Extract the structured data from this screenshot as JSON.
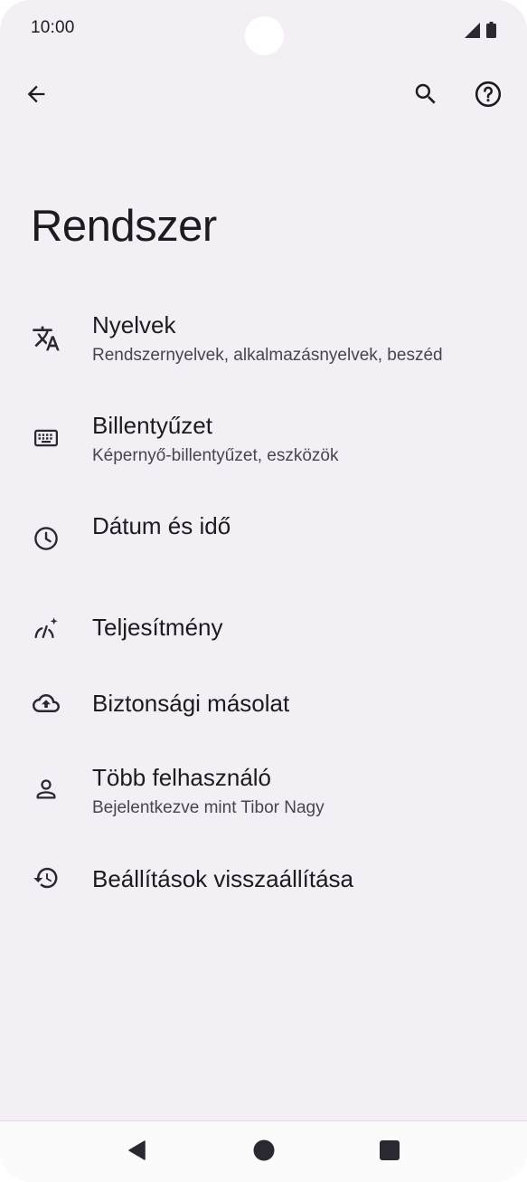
{
  "status_bar": {
    "time": "10:00"
  },
  "app_bar": {
    "back_icon": "arrow-back-icon",
    "search_icon": "search-icon",
    "help_icon": "help-icon"
  },
  "page": {
    "title": "Rendszer"
  },
  "settings": {
    "items": [
      {
        "icon": "translate-icon",
        "title": "Nyelvek",
        "subtitle": "Rendszernyelvek, alkalmazásnyelvek, beszéd"
      },
      {
        "icon": "keyboard-icon",
        "title": "Billentyűzet",
        "subtitle": "Képernyő-billentyűzet, eszközök"
      },
      {
        "icon": "clock-icon",
        "title": "Dátum és idő"
      },
      {
        "icon": "performance-icon",
        "title": "Teljesítmény"
      },
      {
        "icon": "cloud-backup-icon",
        "title": "Biztonsági másolat"
      },
      {
        "icon": "person-icon",
        "title": "Több felhasználó",
        "subtitle": "Bejelentkezve mint Tibor Nagy"
      },
      {
        "icon": "history-icon",
        "title": "Beállítások visszaállítása"
      }
    ]
  },
  "nav_bar": {
    "back_icon": "nav-back-icon",
    "home_icon": "nav-home-icon",
    "recents_icon": "nav-recents-icon"
  },
  "colors": {
    "background": "#f4eef5",
    "text_primary": "#1d1b20",
    "text_secondary": "#47464f",
    "icon": "#2a2830"
  }
}
